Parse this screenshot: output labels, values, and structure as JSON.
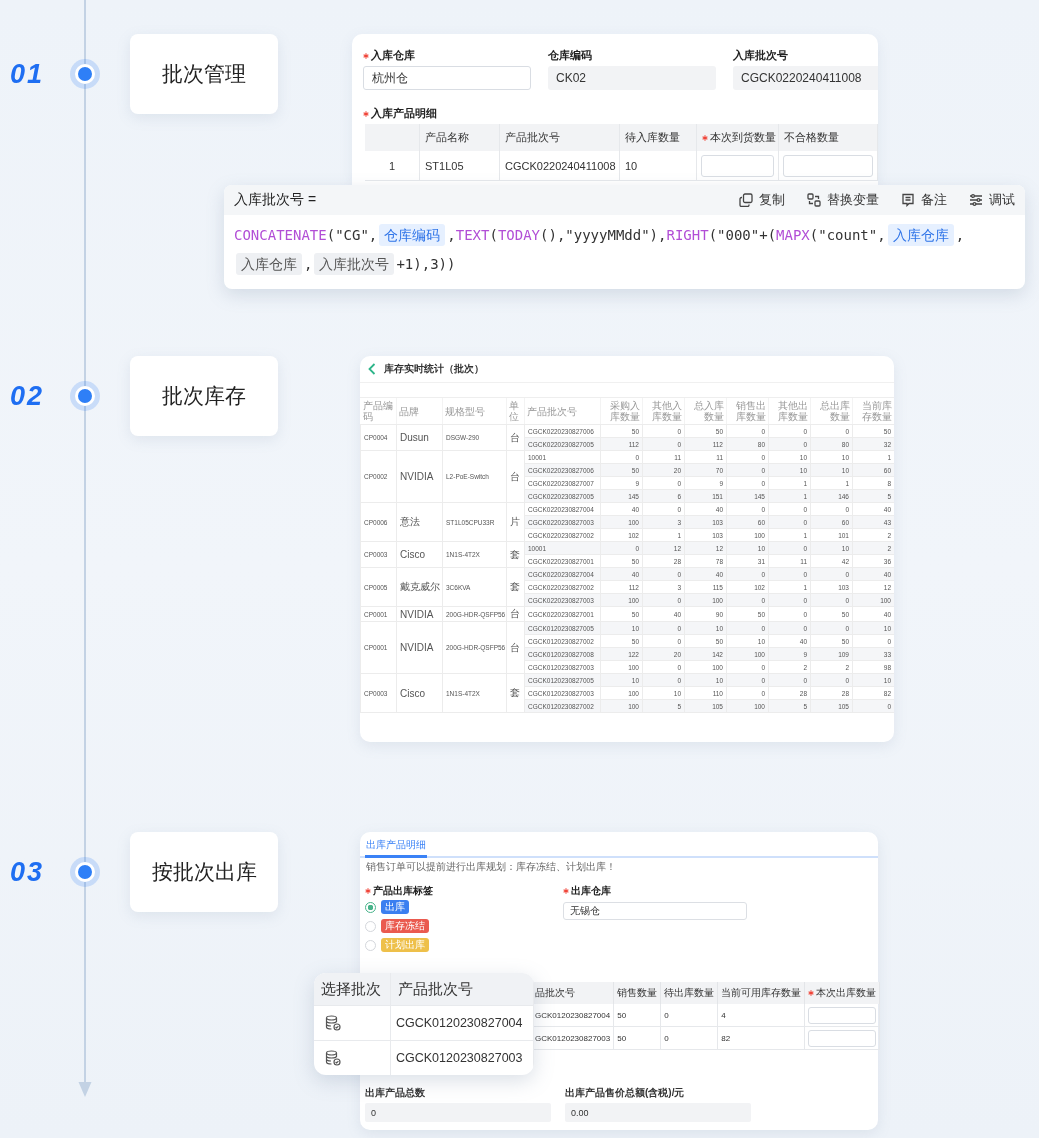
{
  "steps": [
    {
      "number": "01",
      "label": "批次管理",
      "kind": "form",
      "form": {
        "fields": [
          {
            "label": "入库仓库",
            "required": true,
            "value": "杭州仓",
            "editable": true
          },
          {
            "label": "仓库编码",
            "required": false,
            "value": "CK02",
            "editable": false
          },
          {
            "label": "入库批次号",
            "required": false,
            "value": "CGCK0220240411008",
            "editable": false
          }
        ],
        "detail_label": "入库产品明细",
        "detail_required": true,
        "columns": [
          {
            "label": "产品名称",
            "kind": "text",
            "required": false
          },
          {
            "label": "产品批次号",
            "kind": "text",
            "required": false
          },
          {
            "label": "待入库数量",
            "kind": "text",
            "required": false
          },
          {
            "label": "本次到货数量",
            "kind": "input",
            "required": true
          },
          {
            "label": "不合格数量",
            "kind": "input",
            "required": false
          }
        ],
        "rows": [
          {
            "index": "1",
            "cells": [
              "ST1L05",
              "CGCK0220240411008",
              "10"
            ]
          }
        ]
      },
      "formula": {
        "title": "入库批次号 =",
        "actions": [
          {
            "kind": "copy",
            "label": "复制"
          },
          {
            "kind": "replace",
            "label": "替换变量"
          },
          {
            "kind": "note",
            "label": "备注"
          },
          {
            "kind": "debug",
            "label": "调试"
          }
        ],
        "tokens": [
          {
            "kind": "fn",
            "text": "CONCATENATE"
          },
          {
            "kind": "plain",
            "text": "(\"CG\","
          },
          {
            "kind": "field",
            "text": "仓库编码"
          },
          {
            "kind": "plain",
            "text": ","
          },
          {
            "kind": "fn",
            "text": "TEXT"
          },
          {
            "kind": "plain",
            "text": "("
          },
          {
            "kind": "fn",
            "text": "TODAY"
          },
          {
            "kind": "plain",
            "text": "(),\"yyyyMMdd\"),"
          },
          {
            "kind": "fn",
            "text": "RIGHT"
          },
          {
            "kind": "plain",
            "text": "(\"000\"+("
          },
          {
            "kind": "fn",
            "text": "MAPX"
          },
          {
            "kind": "plain",
            "text": "(\"count\","
          },
          {
            "kind": "field",
            "text": "入库仓库"
          },
          {
            "kind": "plain",
            "text": ","
          },
          {
            "kind": "subfield",
            "text": "入库仓库"
          },
          {
            "kind": "plain",
            "text": ","
          },
          {
            "kind": "subfield",
            "text": "入库批次号"
          },
          {
            "kind": "plain",
            "text": "+1),3))"
          }
        ]
      }
    },
    {
      "number": "02",
      "label": "批次库存",
      "kind": "report",
      "report": {
        "title": "库存实时统计（批次）",
        "columns": [
          "产品编码",
          "品牌",
          "规格型号",
          "单位",
          "产品批次号",
          "采购入库数量",
          "其他入库数量",
          "总入库数量",
          "销售出库数量",
          "其他出库数量",
          "总出库数量",
          "当前库存数量"
        ],
        "groups": [
          {
            "code": "CP0004",
            "brand": "Dusun",
            "spec": "DSGW-290",
            "unit": "台",
            "batches": [
              {
                "batch": "CGCK0220230827006",
                "values": [
                  "50",
                  "0",
                  "50",
                  "0",
                  "0",
                  "0",
                  "50"
                ]
              },
              {
                "batch": "CGCK0220230827005",
                "values": [
                  "112",
                  "0",
                  "112",
                  "80",
                  "0",
                  "80",
                  "32"
                ]
              }
            ]
          },
          {
            "code": "CP0002",
            "brand": "NVIDIA",
            "spec": "L2-PoE-Switch",
            "unit": "台",
            "batches": [
              {
                "batch": "10001",
                "values": [
                  "0",
                  "11",
                  "11",
                  "0",
                  "10",
                  "10",
                  "1"
                ]
              },
              {
                "batch": "CGCK0220230827006",
                "values": [
                  "50",
                  "20",
                  "70",
                  "0",
                  "10",
                  "10",
                  "60"
                ]
              },
              {
                "batch": "CGCK0220230827007",
                "values": [
                  "9",
                  "0",
                  "9",
                  "0",
                  "1",
                  "1",
                  "8"
                ]
              },
              {
                "batch": "CGCK0220230827005",
                "values": [
                  "145",
                  "6",
                  "151",
                  "145",
                  "1",
                  "146",
                  "5"
                ]
              }
            ]
          },
          {
            "code": "CP0006",
            "brand": "意法",
            "spec": "ST1L05CPU33R",
            "unit": "片",
            "batches": [
              {
                "batch": "CGCK0220230827004",
                "values": [
                  "40",
                  "0",
                  "40",
                  "0",
                  "0",
                  "0",
                  "40"
                ]
              },
              {
                "batch": "CGCK0220230827003",
                "values": [
                  "100",
                  "3",
                  "103",
                  "60",
                  "0",
                  "60",
                  "43"
                ]
              },
              {
                "batch": "CGCK0220230827002",
                "values": [
                  "102",
                  "1",
                  "103",
                  "100",
                  "1",
                  "101",
                  "2"
                ]
              }
            ]
          },
          {
            "code": "CP0003",
            "brand": "Cisco",
            "spec": "1N1S-4T2X",
            "unit": "套",
            "batches": [
              {
                "batch": "10001",
                "values": [
                  "0",
                  "12",
                  "12",
                  "10",
                  "0",
                  "10",
                  "2"
                ]
              },
              {
                "batch": "CGCK0220230827001",
                "values": [
                  "50",
                  "28",
                  "78",
                  "31",
                  "11",
                  "42",
                  "36"
                ]
              }
            ]
          },
          {
            "code": "CP0005",
            "brand": "戴克威尔",
            "spec": "3C6KVA",
            "unit": "套",
            "batches": [
              {
                "batch": "CGCK0220230827004",
                "values": [
                  "40",
                  "0",
                  "40",
                  "0",
                  "0",
                  "0",
                  "40"
                ]
              },
              {
                "batch": "CGCK0220230827002",
                "values": [
                  "112",
                  "3",
                  "115",
                  "102",
                  "1",
                  "103",
                  "12"
                ]
              },
              {
                "batch": "CGCK0220230827003",
                "values": [
                  "100",
                  "0",
                  "100",
                  "0",
                  "0",
                  "0",
                  "100"
                ]
              }
            ]
          },
          {
            "code": "CP0001",
            "brand": "NVIDIA",
            "spec": "200G-HDR-QSFP56",
            "unit": "台",
            "batches": [
              {
                "batch": "CGCK0220230827001",
                "values": [
                  "50",
                  "40",
                  "90",
                  "50",
                  "0",
                  "50",
                  "40"
                ]
              }
            ]
          },
          {
            "code": "CP0001",
            "brand": "NVIDIA",
            "spec": "200G-HDR-QSFP56",
            "unit": "台",
            "batches": [
              {
                "batch": "CGCK0120230827005",
                "values": [
                  "10",
                  "0",
                  "10",
                  "0",
                  "0",
                  "0",
                  "10"
                ]
              },
              {
                "batch": "CGCK0120230827002",
                "values": [
                  "50",
                  "0",
                  "50",
                  "10",
                  "40",
                  "50",
                  "0"
                ]
              },
              {
                "batch": "CGCK0120230827008",
                "values": [
                  "122",
                  "20",
                  "142",
                  "100",
                  "9",
                  "109",
                  "33"
                ]
              },
              {
                "batch": "CGCK0120230827003",
                "values": [
                  "100",
                  "0",
                  "100",
                  "0",
                  "2",
                  "2",
                  "98"
                ]
              }
            ]
          },
          {
            "code": "CP0003",
            "brand": "Cisco",
            "spec": "1N1S-4T2X",
            "unit": "套",
            "batches": [
              {
                "batch": "CGCK0120230827005",
                "values": [
                  "10",
                  "0",
                  "10",
                  "0",
                  "0",
                  "0",
                  "10"
                ]
              },
              {
                "batch": "CGCK0120230827003",
                "values": [
                  "100",
                  "10",
                  "110",
                  "0",
                  "28",
                  "28",
                  "82"
                ]
              },
              {
                "batch": "CGCK0120230827002",
                "values": [
                  "100",
                  "5",
                  "105",
                  "100",
                  "5",
                  "105",
                  "0"
                ]
              }
            ]
          }
        ]
      }
    },
    {
      "number": "03",
      "label": "按批次出库",
      "kind": "outbound",
      "outbound": {
        "tabs": [
          {
            "label": "出库产品明细",
            "selected": true
          }
        ],
        "note": "销售订单可以提前进行出库规划：库存冻结、计划出库！",
        "tag_label": "产品出库标签",
        "tag_required": true,
        "tags": [
          {
            "text": "出库",
            "color": "#3b7ff0",
            "selected": true
          },
          {
            "text": "库存冻结",
            "color": "#ea5a4f",
            "selected": false
          },
          {
            "text": "计划出库",
            "color": "#eec04a",
            "selected": false
          }
        ],
        "warehouse_label": "出库仓库",
        "warehouse_required": true,
        "warehouse": "无锡仓",
        "columns": [
          {
            "label": "品批次号",
            "required": false
          },
          {
            "label": "销售数量",
            "required": false
          },
          {
            "label": "待出库数量",
            "required": false
          },
          {
            "label": "当前可用库存数量",
            "required": false
          },
          {
            "label": "本次出库数量",
            "required": true
          }
        ],
        "rows": [
          [
            "GCK0120230827004",
            "50",
            "0",
            "4"
          ],
          [
            "GCK0120230827003",
            "50",
            "0",
            "82"
          ]
        ],
        "totals": [
          {
            "label": "出库产品总数",
            "value": "0"
          },
          {
            "label": "出库产品售价总额(含税)/元",
            "value": "0.00"
          }
        ],
        "picker": {
          "columns": [
            "选择批次",
            "产品批次号"
          ],
          "rows": [
            "CGCK0120230827004",
            "CGCK0120230827003"
          ]
        }
      }
    }
  ]
}
